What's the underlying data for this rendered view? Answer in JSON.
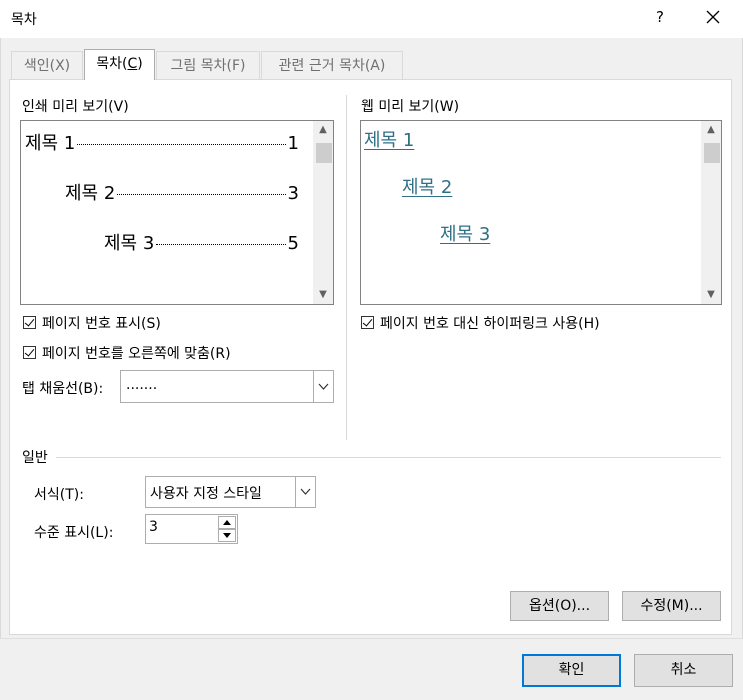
{
  "window": {
    "title": "목차",
    "help_glyph": "?"
  },
  "tabs": [
    {
      "label": "색인(X)",
      "active": false
    },
    {
      "label": "목차(C)",
      "active": true
    },
    {
      "label": "그림 목차(F)",
      "active": false
    },
    {
      "label": "관련 근거 목차(A)",
      "active": false
    }
  ],
  "print_preview": {
    "label": "인쇄 미리 보기(V)",
    "entries": [
      {
        "text": "제목 1",
        "page": "1"
      },
      {
        "text": "제목 2",
        "page": "3"
      },
      {
        "text": "제목 3",
        "page": "5"
      }
    ]
  },
  "web_preview": {
    "label": "웹 미리 보기(W)",
    "entries": [
      "제목 1",
      "제목 2",
      "제목 3"
    ]
  },
  "options": {
    "show_page_numbers": {
      "label": "페이지 번호 표시(S)",
      "checked": true
    },
    "right_align": {
      "label": "페이지 번호를 오른쪽에 맞춤(R)",
      "checked": true
    },
    "tab_leader": {
      "label": "탭 채움선(B):",
      "value": "......."
    },
    "use_hyperlinks": {
      "label": "페이지 번호 대신 하이퍼링크 사용(H)",
      "checked": true
    }
  },
  "general": {
    "heading": "일반",
    "format": {
      "label": "서식(T):",
      "value": "사용자 지정 스타일"
    },
    "levels": {
      "label": "수준 표시(L):",
      "value": "3"
    }
  },
  "buttons": {
    "options": "옵션(O)...",
    "modify": "수정(M)...",
    "ok": "확인",
    "cancel": "취소"
  },
  "colors": {
    "hyperlink": "#2e7186",
    "default_button_border": "#0078d7"
  }
}
